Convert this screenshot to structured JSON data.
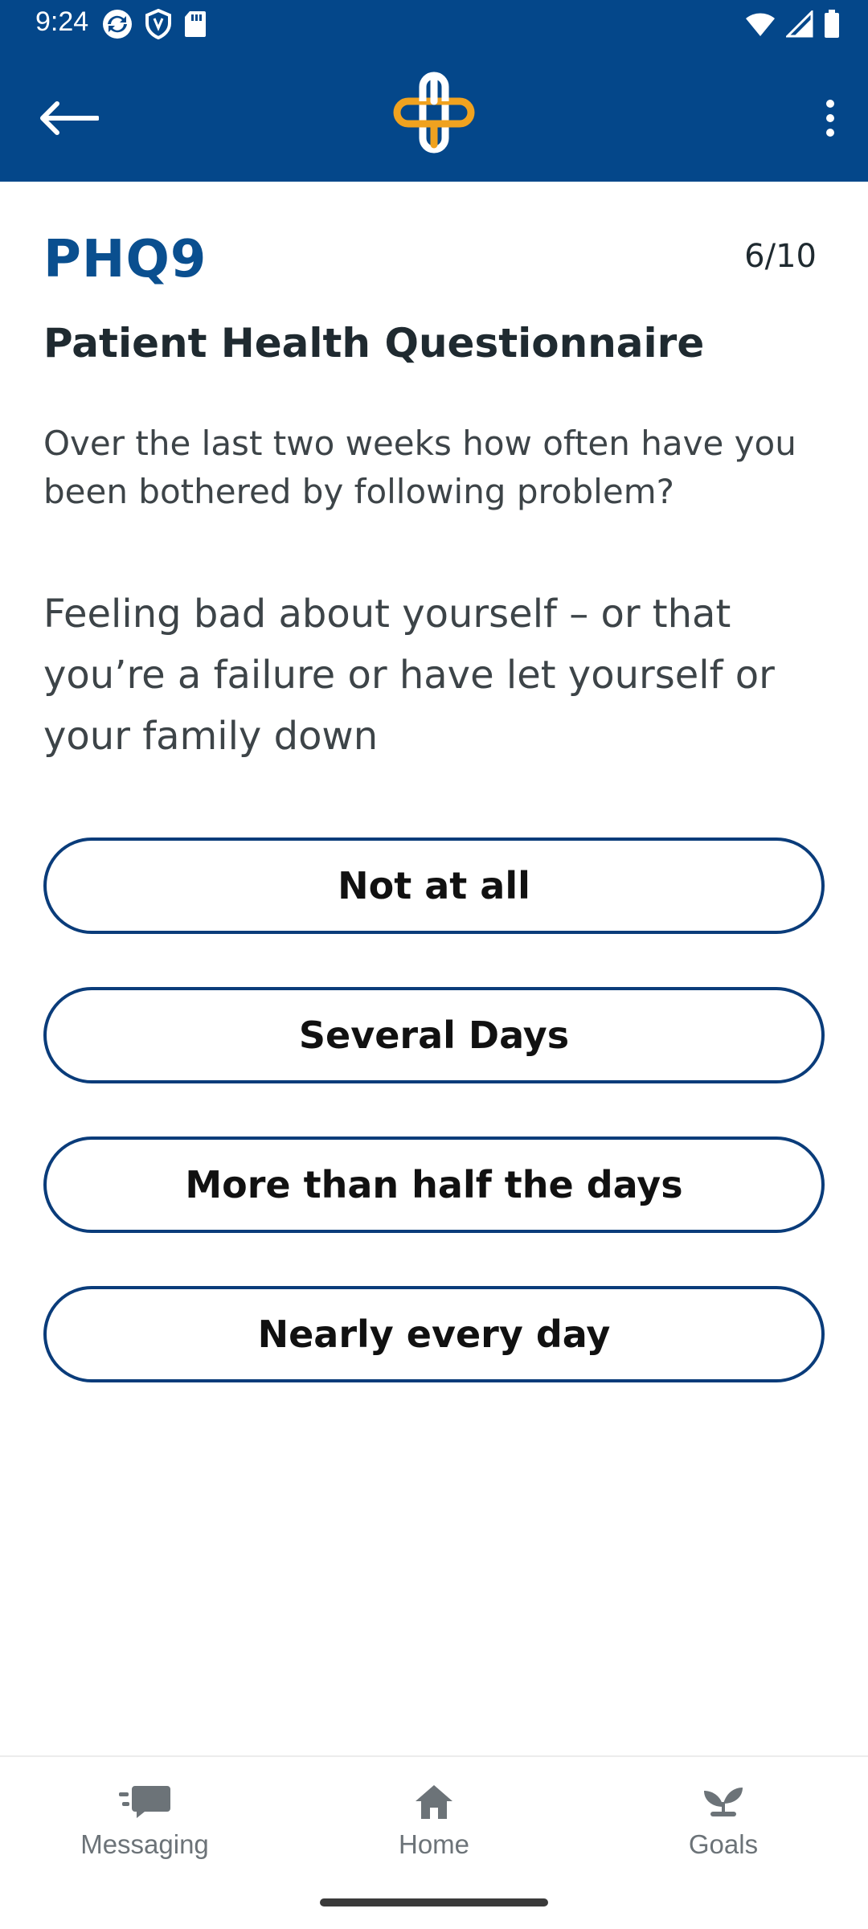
{
  "status_bar": {
    "time": "9:24",
    "left_icons": [
      "sync-icon",
      "shield-icon",
      "sd-card-icon"
    ],
    "right_icons": [
      "wifi-icon",
      "signal-icon",
      "battery-icon"
    ]
  },
  "app_bar": {
    "back_icon": "arrow-left-icon",
    "logo_icon": "health-cross-logo",
    "menu_icon": "more-vert-icon",
    "background_color": "#04478a",
    "logo_colors": [
      "#ffffff",
      "#f0a21f"
    ]
  },
  "questionnaire": {
    "code": "PHQ9",
    "progress": "6/10",
    "title": "Patient Health Questionnaire",
    "instruction": "Over the last two weeks how often have you been bothered by following problem?",
    "question": "Feeling bad about yourself – or that you’re a failure or have let yourself or your family down",
    "options": [
      {
        "label": "Not at all"
      },
      {
        "label": "Several Days"
      },
      {
        "label": "More than half the days"
      },
      {
        "label": "Nearly every day"
      }
    ],
    "accent_color": "#0a4f8f",
    "button_border_color": "#0a3c7a"
  },
  "bottom_nav": {
    "items": [
      {
        "label": "Messaging",
        "icon": "messaging-icon"
      },
      {
        "label": "Home",
        "icon": "home-icon"
      },
      {
        "label": "Goals",
        "icon": "goals-sprout-icon"
      }
    ]
  }
}
